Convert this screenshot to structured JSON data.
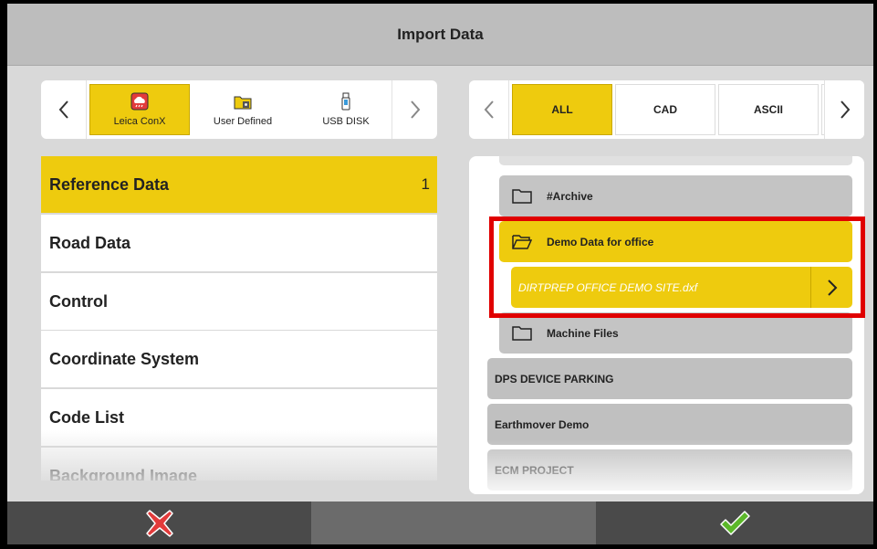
{
  "header": {
    "title": "Import Data"
  },
  "sources": {
    "items": [
      {
        "label": "Leica ConX",
        "icon": "cloud-icon",
        "selected": true
      },
      {
        "label": "User Defined",
        "icon": "folder-lock-icon",
        "selected": false
      },
      {
        "label": "USB DISK",
        "icon": "usb-drive-icon",
        "selected": false
      }
    ]
  },
  "filters": {
    "items": [
      {
        "label": "ALL",
        "selected": true
      },
      {
        "label": "CAD",
        "selected": false
      },
      {
        "label": "ASCII",
        "selected": false
      }
    ]
  },
  "categories": [
    {
      "label": "Reference Data",
      "count": "1",
      "selected": true
    },
    {
      "label": "Road Data",
      "count": "",
      "selected": false
    },
    {
      "label": "Control",
      "count": "",
      "selected": false
    },
    {
      "label": "Coordinate System",
      "count": "",
      "selected": false
    },
    {
      "label": "Code List",
      "count": "",
      "selected": false
    },
    {
      "label": "Background Image",
      "count": "",
      "selected": false
    }
  ],
  "tree": {
    "folders": [
      {
        "label": "#Archive",
        "open": false
      },
      {
        "label": "Demo Data for office",
        "open": true
      },
      {
        "label": "Machine Files",
        "open": false
      }
    ],
    "file": {
      "label": "DIRTPREP OFFICE DEMO SITE.dxf"
    },
    "projects": [
      {
        "label": "DPS DEVICE PARKING"
      },
      {
        "label": "Earthmover Demo"
      },
      {
        "label": "ECM PROJECT"
      }
    ]
  },
  "colors": {
    "accent": "#eecb0e",
    "highlight": "#e00000",
    "cancel": "#e23b3b",
    "confirm": "#5cb82a"
  },
  "footer": {
    "cancel_icon": "cancel-x-icon",
    "confirm_icon": "checkmark-icon"
  }
}
